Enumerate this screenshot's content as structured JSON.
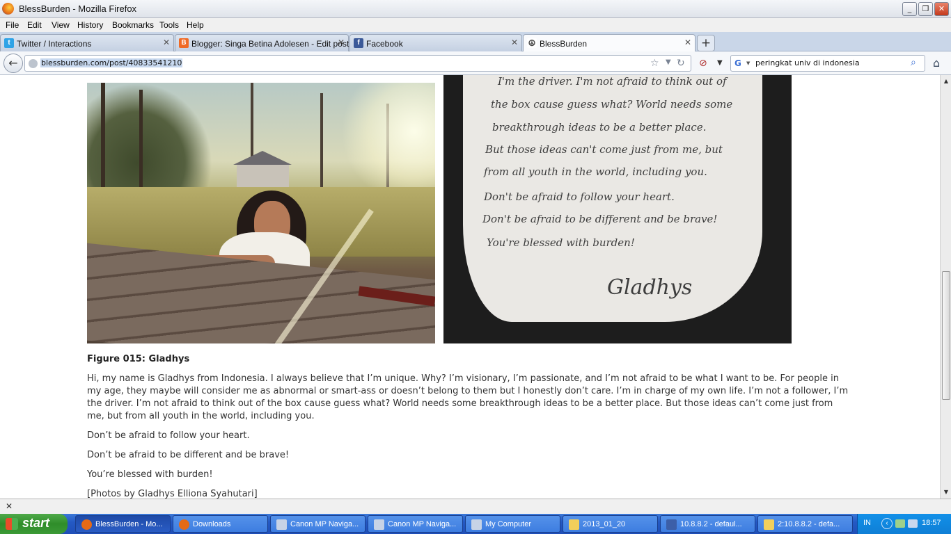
{
  "window": {
    "title": "BlessBurden - Mozilla Firefox",
    "minimize": "_",
    "maximize": "❐",
    "close": "✕"
  },
  "menu": [
    "File",
    "Edit",
    "View",
    "History",
    "Bookmarks",
    "Tools",
    "Help"
  ],
  "tabs": [
    {
      "label": "Twitter / Interactions",
      "icon_color": "#2fa3e6",
      "icon": "t"
    },
    {
      "label": "Blogger: Singa Betina Adolesen - Edit post",
      "icon_color": "#f06a25",
      "icon": "B"
    },
    {
      "label": "Facebook",
      "icon_color": "#3b5998",
      "icon": "f"
    },
    {
      "label": "BlessBurden",
      "icon_color": "#ffffff",
      "icon": "☮"
    }
  ],
  "tab_close": "✕",
  "new_tab": "+",
  "nav": {
    "back": "←",
    "url": "blessburden.com/post/40833541210",
    "search_query": "peringkat univ di indonesia"
  },
  "note": {
    "lines": [
      "I'm the driver. I'm not afraid to think out of",
      "the box cause guess what? World needs some",
      "breakthrough ideas to be a better place.",
      "But those ideas can't come just from me, but",
      "from all youth in the world, including you.",
      "Don't be afraid to follow your heart.",
      "Don't be afraid to be different and be brave!",
      "You're blessed with burden!"
    ],
    "signature": "Gladhys"
  },
  "article": {
    "caption": "Figure 015: Gladhys",
    "paragraphs": [
      "Hi, my name is Gladhys from Indonesia. I always believe that I’m unique. Why? I’m visionary, I’m passionate, and I’m not afraid to be what I want to be. For people in my age, they maybe will consider me as abnormal or smart-ass or doesn’t belong to them but I honestly don’t care. I’m in charge of my own life. I’m not a follower, I’m the driver. I’m not afraid to think out of the box cause guess what? World needs some breakthrough ideas to be a better place. But those ideas can’t come just from me, but from all youth in the world, including you.",
      "Don’t be afraid to follow your heart.",
      "Don’t be afraid to be different and be brave!",
      "You’re blessed with burden!",
      "[Photos by Gladhys Elliona Syahutari]"
    ]
  },
  "findbar_close": "✕",
  "taskbar": {
    "start": "start",
    "tasks": [
      {
        "label": "BlessBurden - Mo...",
        "icon_color": "#e56a16",
        "active": true
      },
      {
        "label": "Downloads",
        "icon_color": "#e56a16",
        "active": false
      },
      {
        "label": "Canon MP Naviga...",
        "icon_color": "#c7d3e6",
        "active": false
      },
      {
        "label": "Canon MP Naviga...",
        "icon_color": "#c7d3e6",
        "active": false
      },
      {
        "label": "My Computer",
        "icon_color": "#c7d3e6",
        "active": false
      },
      {
        "label": "2013_01_20",
        "icon_color": "#f2cf5b",
        "active": false
      },
      {
        "label": "10.8.8.2 - defaul...",
        "icon_color": "#3c5fa8",
        "active": false
      },
      {
        "label": "2:10.8.8.2 - defa...",
        "icon_color": "#f2cf5b",
        "active": false
      }
    ],
    "language": "IN",
    "clock": "18:57"
  }
}
